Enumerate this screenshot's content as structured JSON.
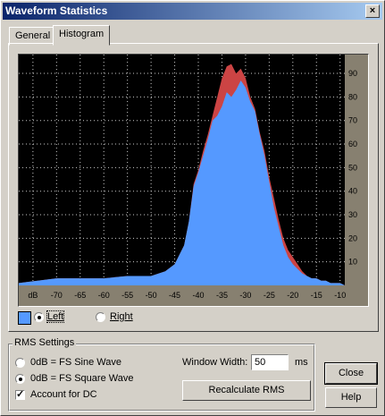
{
  "window": {
    "title": "Waveform Statistics",
    "close_glyph": "×"
  },
  "tabs": [
    {
      "label": "General",
      "active": false
    },
    {
      "label": "Histogram",
      "active": true
    }
  ],
  "histogram": {
    "x_tick_labels": [
      "dB",
      "-70",
      "-65",
      "-60",
      "-55",
      "-50",
      "-45",
      "-40",
      "-35",
      "-30",
      "-25",
      "-20",
      "-15",
      "-10"
    ],
    "y_tick_labels": [
      "90",
      "80",
      "70",
      "60",
      "50",
      "40",
      "30",
      "20",
      "10"
    ],
    "colors": {
      "background": "#000000",
      "left_fill": "#5599ff",
      "right_fill": "#cc4444",
      "grid": "#cccccc",
      "panel": "#878070"
    }
  },
  "chart_data": {
    "type": "area",
    "title": "",
    "xlabel": "dB",
    "ylabel": "",
    "xlim": [
      -78,
      -9
    ],
    "ylim": [
      0,
      98
    ],
    "series": [
      {
        "name": "Left",
        "x": [
          -78,
          -70,
          -65,
          -60,
          -55,
          -50,
          -47,
          -45,
          -43,
          -42,
          -41,
          -40,
          -39,
          -38,
          -37,
          -36,
          -35,
          -34,
          -33,
          -32,
          -31,
          -30,
          -29,
          -28,
          -27,
          -26,
          -25,
          -24,
          -23,
          -22,
          -21,
          -20,
          -19,
          -18,
          -17,
          -16,
          -15,
          -14,
          -13,
          -12,
          -11,
          -10,
          -9
        ],
        "y": [
          1,
          3,
          3,
          3,
          4,
          4,
          6,
          9,
          17,
          27,
          42,
          48,
          55,
          62,
          70,
          72,
          76,
          82,
          80,
          83,
          87,
          84,
          78,
          74,
          64,
          55,
          44,
          33,
          25,
          17,
          12,
          9,
          7,
          5,
          4,
          3,
          3,
          2,
          2,
          1,
          1,
          1,
          0
        ]
      },
      {
        "name": "Right",
        "x": [
          -78,
          -70,
          -65,
          -60,
          -55,
          -50,
          -47,
          -45,
          -43,
          -42,
          -41,
          -40,
          -39,
          -38,
          -37,
          -36,
          -35,
          -34,
          -33,
          -32,
          -31,
          -30,
          -29,
          -28,
          -27,
          -26,
          -25,
          -24,
          -23,
          -22,
          -21,
          -20,
          -19,
          -18,
          -17,
          -16,
          -15,
          -14,
          -13,
          -12,
          -11,
          -10,
          -9
        ],
        "y": [
          1,
          3,
          3,
          3,
          4,
          4,
          6,
          9,
          17,
          27,
          43,
          49,
          57,
          64,
          72,
          80,
          88,
          93,
          94,
          90,
          92,
          88,
          80,
          75,
          65,
          57,
          46,
          37,
          28,
          20,
          15,
          12,
          9,
          6,
          4,
          3,
          3,
          2,
          2,
          1,
          1,
          1,
          0
        ]
      }
    ]
  },
  "legend": {
    "left_label": "Left",
    "right_label": "Right",
    "selected": "Left"
  },
  "rms": {
    "group_title": "RMS Settings",
    "sine_label": "0dB = FS Sine Wave",
    "square_label": "0dB = FS Square Wave",
    "selected": "square",
    "dc_label": "Account for DC",
    "dc_checked": true,
    "window_width_label": "Window Width:",
    "window_width_value": "50",
    "window_width_unit": "ms",
    "recalculate_label": "Recalculate RMS"
  },
  "buttons": {
    "close": "Close",
    "help": "Help"
  }
}
